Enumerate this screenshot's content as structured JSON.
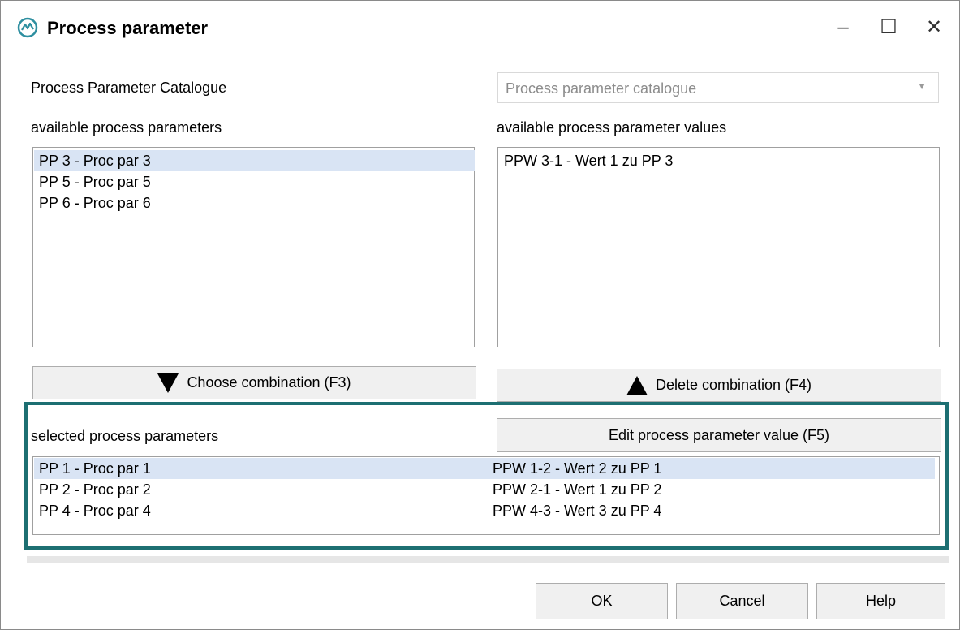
{
  "window": {
    "title": "Process parameter",
    "controls": {
      "minimize": "–",
      "maximize": "☐",
      "close": "✕"
    }
  },
  "catalogue": {
    "label": "Process Parameter Catalogue",
    "placeholder": "Process parameter catalogue"
  },
  "available_params": {
    "label": "available process parameters",
    "items": [
      {
        "text": "PP 3 - Proc par 3",
        "selected": true
      },
      {
        "text": "PP 5 - Proc par 5",
        "selected": false
      },
      {
        "text": "PP 6 - Proc par 6",
        "selected": false
      }
    ]
  },
  "available_values": {
    "label": "available process parameter values",
    "items": [
      {
        "text": "PPW 3-1 - Wert 1 zu PP 3",
        "selected": false
      }
    ]
  },
  "buttons": {
    "choose": "Choose combination (F3)",
    "delete": "Delete combination (F4)",
    "edit": "Edit process parameter value (F5)",
    "ok": "OK",
    "cancel": "Cancel",
    "help": "Help"
  },
  "selected": {
    "label": "selected process parameters",
    "rows": [
      {
        "param": "PP 1 - Proc par 1",
        "value": "PPW 1-2 - Wert 2 zu PP 1",
        "selected": true
      },
      {
        "param": "PP 2 - Proc par 2",
        "value": "PPW 2-1 - Wert 1 zu PP 2",
        "selected": false
      },
      {
        "param": "PP 4 - Proc par 4",
        "value": "PPW 4-3 - Wert 3 zu PP 4",
        "selected": false
      }
    ]
  },
  "colors": {
    "highlight_frame": "#1d6f72",
    "selection": "#d9e4f4",
    "app_icon": "#2e8fa0"
  },
  "icons": {
    "app": "process-gear-icon",
    "choose": "triangle-down-icon",
    "delete": "triangle-up-icon",
    "dropdown": "chevron-down-icon"
  }
}
